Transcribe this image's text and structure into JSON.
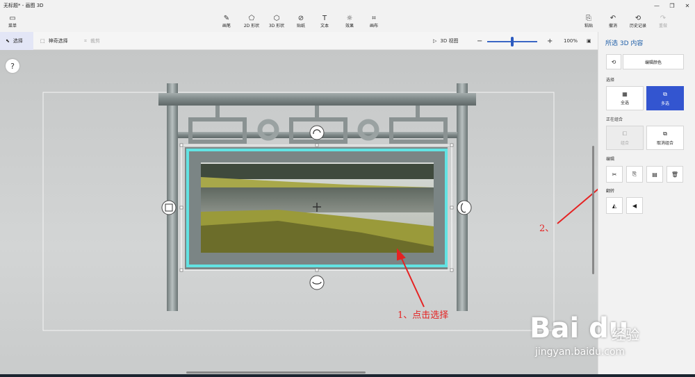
{
  "window": {
    "title": "无标题* - 画图 3D"
  },
  "ribbon": {
    "menu": "菜单",
    "tools": [
      "画笔",
      "2D 形状",
      "3D 形状",
      "贴纸",
      "文本",
      "效果",
      "画布"
    ],
    "paste": "粘贴",
    "undo": "撤消",
    "history": "历史记录",
    "redo": "重做"
  },
  "toolbar": {
    "select": "选择",
    "magic_select": "神奇选择",
    "crop": "裁剪",
    "view3d": "3D 视图",
    "zoom_minus": "−",
    "zoom_plus": "+",
    "zoom_value": "100%",
    "zoom_fraction": 0.5
  },
  "canvas": {
    "help": "?"
  },
  "panel": {
    "title": "所选 3D 内容",
    "edit_color": "编辑颜色",
    "select_section": "选择",
    "select_all": "全选",
    "multi_select": "多选",
    "grouping_section": "正在组合",
    "group": "组合",
    "ungroup": "取消组合",
    "edit_section": "编辑",
    "flip_section": "翻转"
  },
  "annotations": {
    "step1": "1、点击选择",
    "step2": "2、"
  },
  "watermark": {
    "logo": "Bai du",
    "cn": "经验",
    "url": "jingyan.baidu.com"
  },
  "colors": {
    "accent": "#3355d0",
    "selection": "#62e3e3",
    "annotation": "#e52222"
  }
}
